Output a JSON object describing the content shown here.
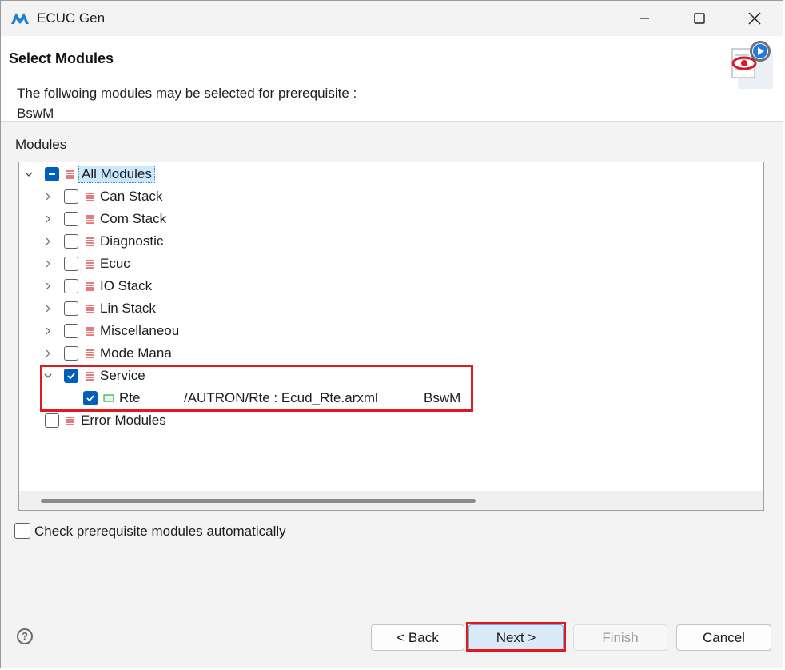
{
  "window": {
    "title": "ECUC Gen",
    "minimize_icon": "minimize-icon",
    "maximize_icon": "maximize-icon",
    "close_icon": "close-icon"
  },
  "banner": {
    "title": "Select Modules",
    "desc_line1": "The follwoing modules may be selected for prerequisite :",
    "desc_line2": "BswM",
    "icon": "wizard-settings-icon"
  },
  "modules": {
    "group_label": "Modules",
    "tree": {
      "root": {
        "label": "All Modules",
        "state": "partial",
        "expanded": true
      },
      "items": [
        {
          "label": "Can Stack",
          "checked": false,
          "expanded": false
        },
        {
          "label": "Com Stack",
          "checked": false,
          "expanded": false
        },
        {
          "label": "Diagnostic",
          "checked": false,
          "expanded": false
        },
        {
          "label": "Ecuc",
          "checked": false,
          "expanded": false
        },
        {
          "label": "IO Stack",
          "checked": false,
          "expanded": false
        },
        {
          "label": "Lin Stack",
          "checked": false,
          "expanded": false
        },
        {
          "label": "Miscellaneou",
          "checked": false,
          "expanded": false
        },
        {
          "label": "Mode Mana",
          "checked": false,
          "expanded": false
        },
        {
          "label": "Service",
          "checked": true,
          "expanded": true
        }
      ],
      "service_child": {
        "label": "Rte",
        "path": "/AUTRON/Rte : Ecud_Rte.arxml",
        "prerequisite": "BswM",
        "checked": true
      },
      "error_modules": {
        "label": "Error Modules",
        "checked": false
      }
    }
  },
  "options": {
    "auto_check_label": "Check prerequisite modules automatically",
    "auto_check_checked": false
  },
  "footer": {
    "help_icon": "help-icon",
    "help_glyph": "?",
    "back_label": "< Back",
    "next_label": "Next >",
    "finish_label": "Finish",
    "cancel_label": "Cancel"
  },
  "colors": {
    "accent": "#005fb8",
    "highlight": "#e0191f",
    "module_icon": "#e05a5a",
    "leaf_icon": "#3aa84a"
  }
}
